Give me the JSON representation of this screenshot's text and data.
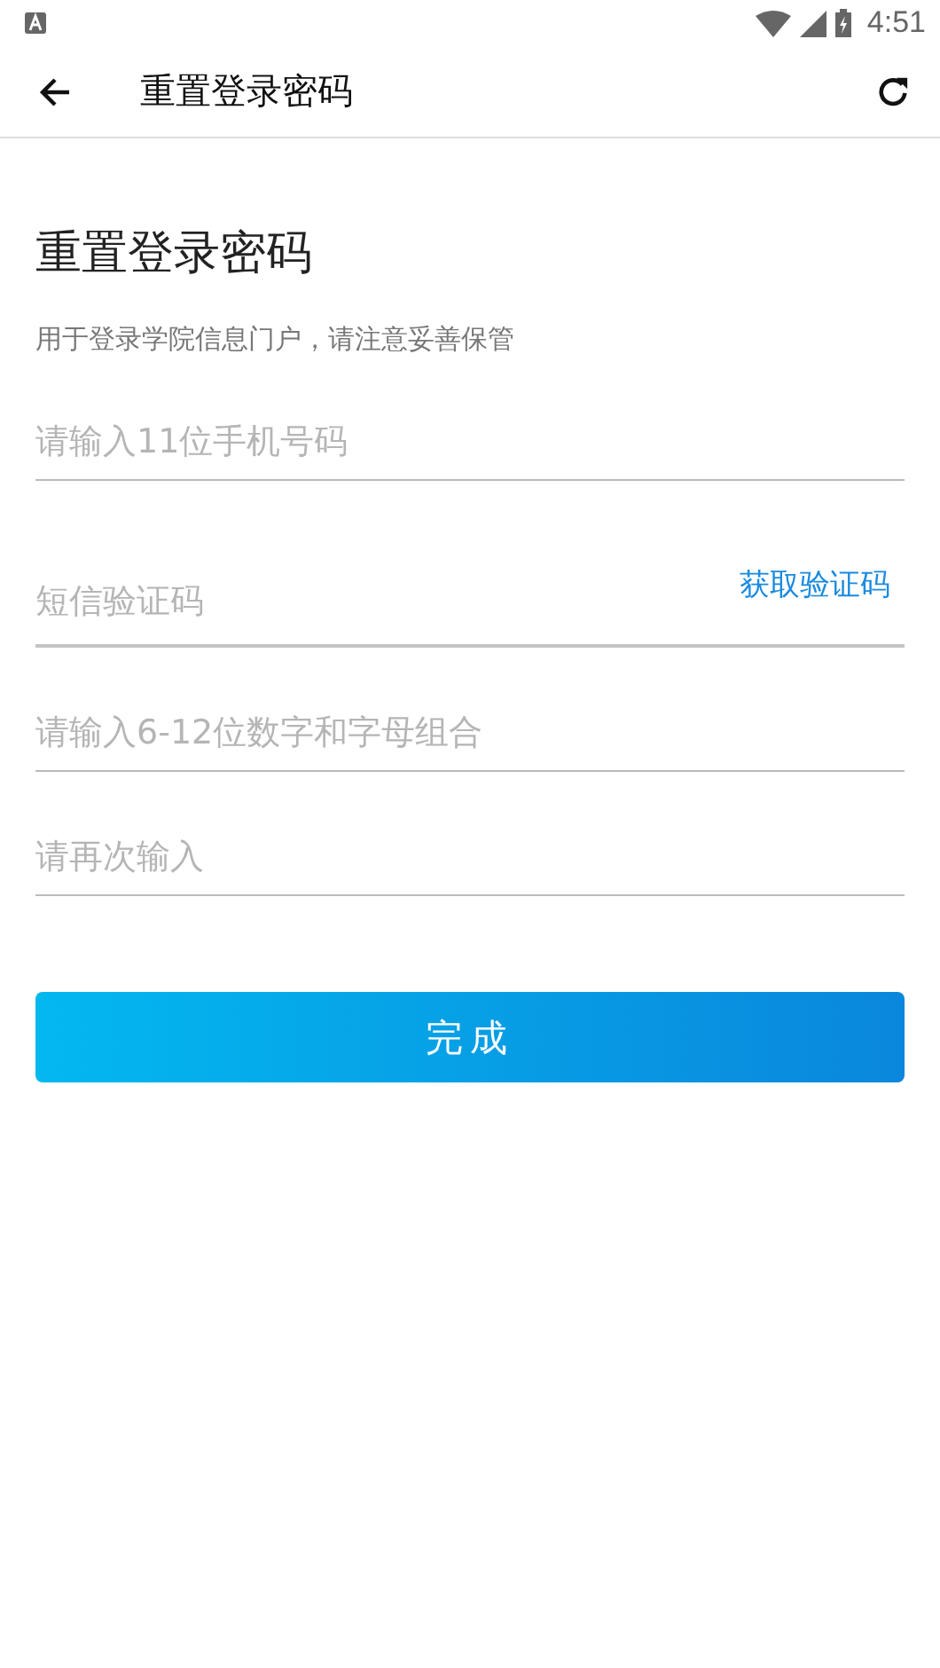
{
  "status_bar": {
    "time": "4:51"
  },
  "app_bar": {
    "title": "重置登录密码"
  },
  "heading": "重置登录密码",
  "subtitle": "用于登录学院信息门户，请注意妥善保管",
  "fields": [
    {
      "kind": "text",
      "placeholder": "请输入11位手机号码"
    },
    {
      "kind": "code",
      "placeholder": "短信验证码",
      "action": "获取验证码"
    },
    {
      "kind": "text",
      "placeholder": "请输入6-12位数字和字母组合"
    },
    {
      "kind": "text",
      "placeholder": "请再次输入"
    }
  ],
  "submit": "完成"
}
